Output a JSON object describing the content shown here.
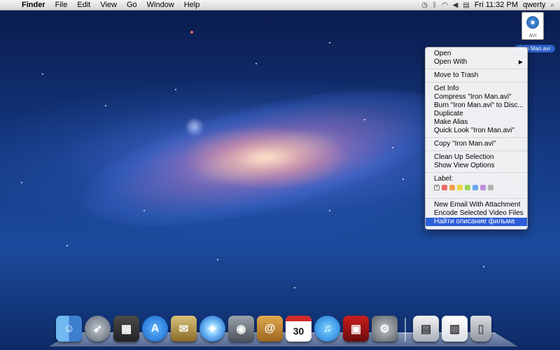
{
  "menubar": {
    "apple_icon": "apple-icon",
    "app_name": "Finder",
    "menus": [
      "File",
      "Edit",
      "View",
      "Go",
      "Window",
      "Help"
    ],
    "status_icons": [
      "time-machine-icon",
      "bluetooth-icon",
      "wifi-icon",
      "volume-icon",
      "flag-icon"
    ],
    "clock": "Fri 11:32 PM",
    "user": "qwerty",
    "spotlight_icon": "magnifier-icon"
  },
  "desktop_file": {
    "name": "Iron Man.avi",
    "badge": "AVI"
  },
  "context_menu": {
    "group1": [
      "Open",
      "Open With"
    ],
    "group2": [
      "Move to Trash"
    ],
    "group3": [
      "Get Info",
      "Compress \"Iron Man.avi\"",
      "Burn \"Iron Man.avi\" to Disc...",
      "Duplicate",
      "Make Alias",
      "Quick Look \"Iron Man.avi\""
    ],
    "group4": [
      "Copy \"Iron Man.avi\""
    ],
    "group5": [
      "Clean Up Selection",
      "Show View Options"
    ],
    "label_title": "Label:",
    "label_colors": [
      "#f06a6a",
      "#f3a04a",
      "#f0d54a",
      "#9bd35a",
      "#6aa9f2",
      "#c28ee0",
      "#b3b3b3"
    ],
    "group6": [
      "New Email With Attachment",
      "Encode Selected Video Files",
      "Найти описание фильма"
    ],
    "highlight_color": "#2d5fd8"
  },
  "dock": {
    "calendar_month": "JUL",
    "calendar_day": "30",
    "apps": [
      "finder-icon",
      "launchpad-icon",
      "mission-control-icon",
      "app-store-icon",
      "mail-icon",
      "safari-icon",
      "facetime-icon",
      "address-book-icon",
      "ical-icon",
      "itunes-icon",
      "photo-booth-icon",
      "system-preferences-icon",
      "preview-icon",
      "documents-icon",
      "trash-icon"
    ]
  }
}
